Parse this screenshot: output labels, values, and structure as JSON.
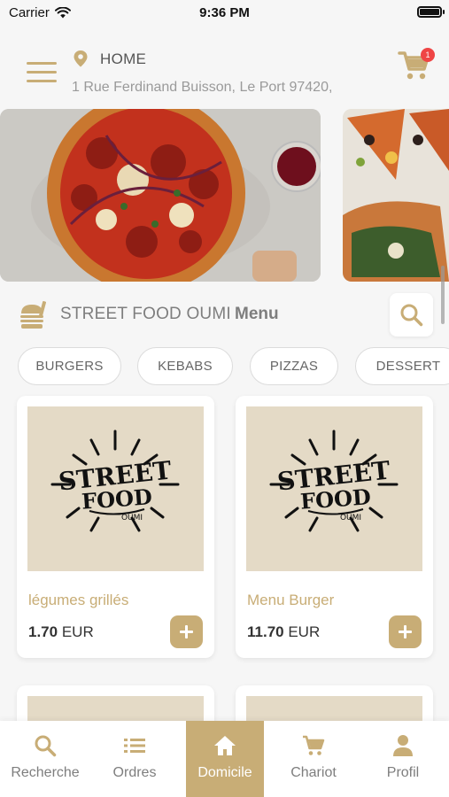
{
  "status_bar": {
    "carrier": "Carrier",
    "time": "9:36 PM"
  },
  "header": {
    "location_label": "HOME",
    "address": "1 Rue Ferdinand Buisson, Le Port 97420,",
    "cart_count": "1"
  },
  "restaurant": {
    "name": "STREET FOOD OUMI",
    "menu_label": "Menu"
  },
  "categories": [
    "BURGERS",
    "KEBABS",
    "PIZZAS",
    "DESSERT"
  ],
  "products": [
    {
      "name": "légumes grillés",
      "price": "1.70",
      "currency": "EUR",
      "logo_text": [
        "STREET",
        "FOOD",
        "OUMI"
      ]
    },
    {
      "name": "Menu Burger",
      "price": "11.70",
      "currency": "EUR",
      "logo_text": [
        "STREET",
        "FOOD",
        "OUMI"
      ]
    }
  ],
  "tabs": [
    {
      "label": "Recherche",
      "icon": "search-icon",
      "active": false
    },
    {
      "label": "Ordres",
      "icon": "list-icon",
      "active": false
    },
    {
      "label": "Domicile",
      "icon": "home-icon",
      "active": true
    },
    {
      "label": "Chariot",
      "icon": "cart-icon",
      "active": false
    },
    {
      "label": "Profil",
      "icon": "profile-icon",
      "active": false
    }
  ],
  "colors": {
    "accent": "#c8ad76",
    "badge": "#ef4545",
    "thumb_bg": "#e4dac6"
  }
}
